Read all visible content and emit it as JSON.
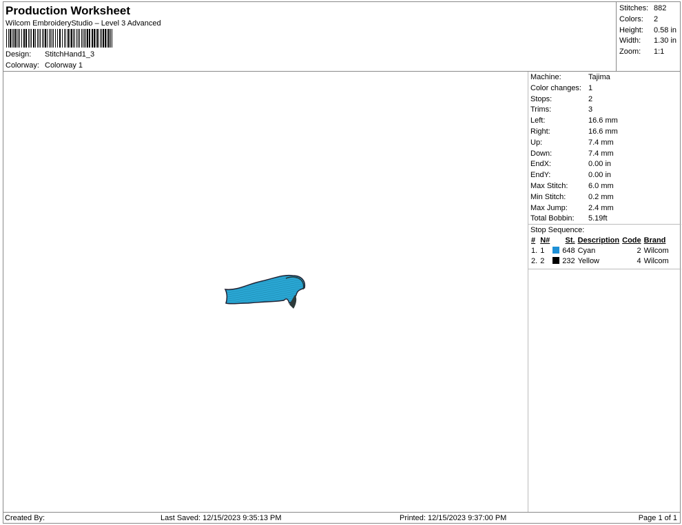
{
  "header": {
    "title": "Production Worksheet",
    "subtitle": "Wilcom EmbroideryStudio – Level 3 Advanced",
    "design_label": "Design:",
    "design": "StitchHand1_3",
    "colorway_label": "Colorway:",
    "colorway": "Colorway 1"
  },
  "summary": [
    {
      "k": "Stitches:",
      "v": "882"
    },
    {
      "k": "Colors:",
      "v": "2"
    },
    {
      "k": "Height:",
      "v": "0.58 in"
    },
    {
      "k": "Width:",
      "v": "1.30 in"
    },
    {
      "k": "Zoom:",
      "v": "1:1"
    }
  ],
  "details": [
    {
      "k": "Machine:",
      "v": "Tajima"
    },
    {
      "k": "Color changes:",
      "v": "1"
    },
    {
      "k": "Stops:",
      "v": "2"
    },
    {
      "k": "Trims:",
      "v": "3"
    },
    {
      "k": "Left:",
      "v": "16.6 mm"
    },
    {
      "k": "Right:",
      "v": "16.6 mm"
    },
    {
      "k": "Up:",
      "v": "7.4 mm"
    },
    {
      "k": "Down:",
      "v": "7.4 mm"
    },
    {
      "k": "EndX:",
      "v": "0.00 in"
    },
    {
      "k": "EndY:",
      "v": "0.00 in"
    },
    {
      "k": "Max Stitch:",
      "v": "6.0 mm"
    },
    {
      "k": "Min Stitch:",
      "v": "0.2 mm"
    },
    {
      "k": "Max Jump:",
      "v": "2.4 mm"
    },
    {
      "k": "Total Bobbin:",
      "v": "5.19ft"
    }
  ],
  "stop_sequence": {
    "label": "Stop Sequence:",
    "columns": [
      "#",
      "N#",
      "",
      "St.",
      "Description",
      "Code",
      "Brand"
    ],
    "rows": [
      {
        "n": "1.",
        "nn": "1",
        "color": "#1e90d6",
        "st": "648",
        "desc": "Cyan",
        "code": "2",
        "brand": "Wilcom"
      },
      {
        "n": "2.",
        "nn": "2",
        "color": "#000000",
        "st": "232",
        "desc": "Yellow",
        "code": "4",
        "brand": "Wilcom"
      }
    ]
  },
  "footer": {
    "created": "Created By:",
    "saved": "Last Saved: 12/15/2023 9:35:13 PM",
    "printed": "Printed: 12/15/2023 9:37:00 PM",
    "page": "Page 1 of 1"
  },
  "design_fill_color": "#2aa7d4"
}
